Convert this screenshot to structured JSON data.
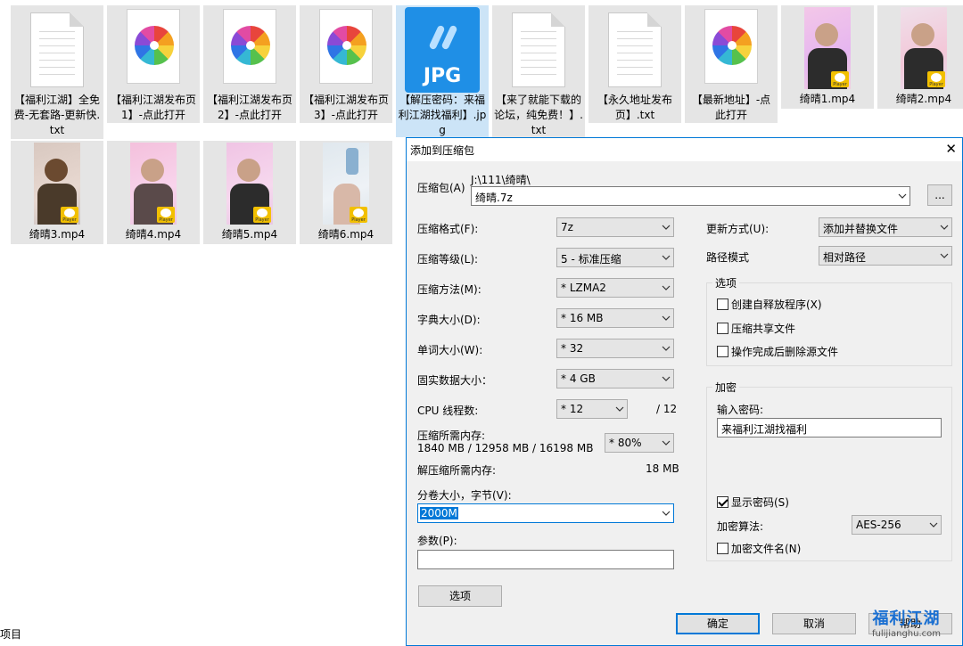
{
  "explorer": {
    "files": [
      {
        "name": "【福利江湖】全免费-无套路-更新快.txt",
        "type": "txt",
        "selected": false
      },
      {
        "name": "【福利江湖发布页1】-点此打开",
        "type": "shortcut",
        "selected": false
      },
      {
        "name": "【福利江湖发布页2】-点此打开",
        "type": "shortcut",
        "selected": false
      },
      {
        "name": "【福利江湖发布页3】-点此打开",
        "type": "shortcut",
        "selected": false
      },
      {
        "name": "【解压密码：来福利江湖找福利】.jpg",
        "type": "jpg",
        "selected": true
      },
      {
        "name": "【来了就能下载的论坛，纯免费！】.txt",
        "type": "txt",
        "selected": false
      },
      {
        "name": "【永久地址发布页】.txt",
        "type": "txt",
        "selected": false
      },
      {
        "name": "【最新地址】-点此打开",
        "type": "shortcut",
        "selected": false
      },
      {
        "name": "绮晴1.mp4",
        "type": "mp4",
        "selected": false
      },
      {
        "name": "绮晴2.mp4",
        "type": "mp4",
        "selected": false
      },
      {
        "name": "绮晴3.mp4",
        "type": "mp4",
        "selected": false
      },
      {
        "name": "绮晴4.mp4",
        "type": "mp4",
        "selected": false
      },
      {
        "name": "绮晴5.mp4",
        "type": "mp4",
        "selected": false
      },
      {
        "name": "绮晴6.mp4",
        "type": "mp4",
        "selected": false
      }
    ],
    "jpg_badge": "JPG",
    "player_badge": "Player",
    "status_text": "项目"
  },
  "dialog": {
    "title": "添加到压缩包",
    "archive_label": "压缩包(A)",
    "archive_path": "J:\\111\\绮晴\\",
    "archive_name": "绮晴.7z",
    "browse_label": "...",
    "format_label": "压缩格式(F):",
    "format_value": "7z",
    "level_label": "压缩等级(L):",
    "level_value": "5 - 标准压缩",
    "method_label": "压缩方法(M):",
    "method_value": "*  LZMA2",
    "dict_label": "字典大小(D):",
    "dict_value": "*  16 MB",
    "word_label": "单词大小(W):",
    "word_value": "*  32",
    "solid_label": "固实数据大小：",
    "solid_value": "*  4 GB",
    "cpu_label": "CPU 线程数:",
    "cpu_value": "*  12",
    "cpu_total": "/ 12",
    "mem_label": "压缩所需内存:",
    "mem_detail": "1840 MB / 12958 MB / 16198 MB",
    "mem_percent": "* 80%",
    "decomp_mem_label": "解压缩所需内存:",
    "decomp_mem_value": "18 MB",
    "volume_label": "分卷大小，字节(V):",
    "volume_value": "2000M",
    "params_label": "参数(P):",
    "params_value": "",
    "options_button": "选项",
    "update_label": "更新方式(U):",
    "update_value": "添加并替换文件",
    "path_label": "路径模式",
    "path_value": "相对路径",
    "options_group": "选项",
    "opt_sfx": "创建自释放程序(X)",
    "opt_sfx_checked": false,
    "opt_shared": "压缩共享文件",
    "opt_shared_checked": false,
    "opt_delete": "操作完成后删除源文件",
    "opt_delete_checked": false,
    "encryption_group": "加密",
    "password_label": "输入密码:",
    "password_value": "来福利江湖找福利",
    "show_password": "显示密码(S)",
    "show_password_checked": true,
    "enc_method_label": "加密算法:",
    "enc_method_value": "AES-256",
    "enc_filenames": "加密文件名(N)",
    "enc_filenames_checked": false,
    "ok_button": "确定",
    "cancel_button": "取消",
    "help_button": "帮助"
  },
  "watermark": {
    "text": "福利江湖",
    "url": "fulijianghu.com"
  },
  "colors": {
    "accent": "#0078d7",
    "selection": "#cce4f7",
    "tile": "#e5e5e5",
    "jpg": "#1f8fe6",
    "badge": "#f2c000"
  }
}
